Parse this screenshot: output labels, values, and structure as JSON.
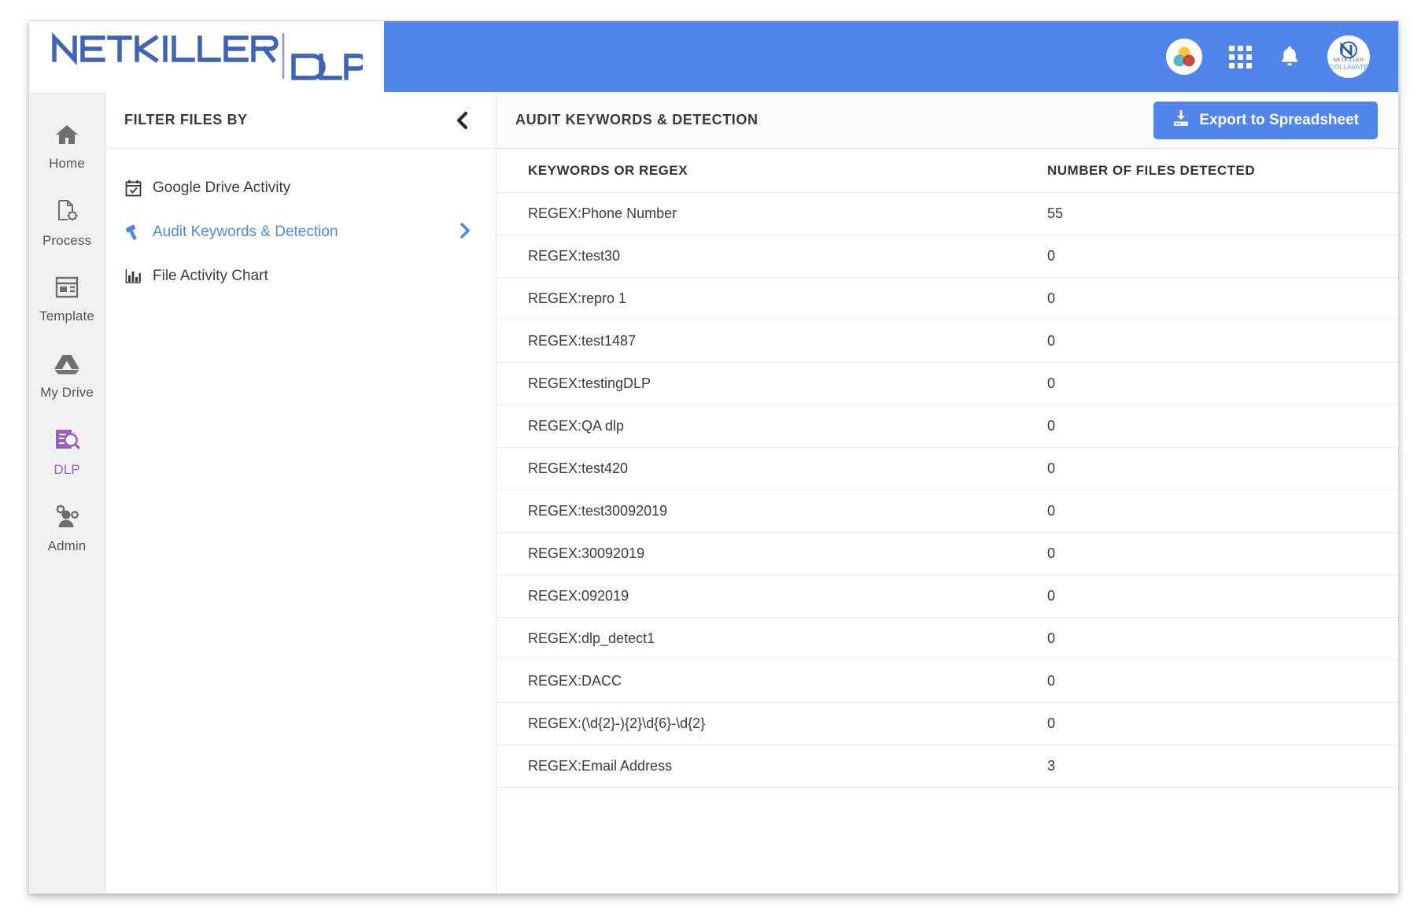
{
  "app": {
    "logo_primary": "NETKILLER",
    "logo_secondary": "DLP",
    "accent_blue": "#5185ec",
    "accent_purple": "#9b5fc0"
  },
  "topbar": {
    "icons": [
      {
        "name": "collavate-circles-icon",
        "label": "Collavate"
      },
      {
        "name": "apps-grid-icon",
        "label": "Apps"
      },
      {
        "name": "notifications-bell-icon",
        "label": "Notifications"
      },
      {
        "name": "account-avatar-icon",
        "label": "Netkiller Collavate"
      }
    ],
    "avatar_line1": "NETKILLER",
    "avatar_line2": "COLLAVATE"
  },
  "sidebar": {
    "items": [
      {
        "label": "Home",
        "icon": "home-icon",
        "active": false
      },
      {
        "label": "Process",
        "icon": "process-icon",
        "active": false
      },
      {
        "label": "Template",
        "icon": "template-icon",
        "active": false
      },
      {
        "label": "My Drive",
        "icon": "drive-icon",
        "active": false
      },
      {
        "label": "DLP",
        "icon": "dlp-icon",
        "active": true
      },
      {
        "label": "Admin",
        "icon": "admin-icon",
        "active": false
      }
    ]
  },
  "filter_panel": {
    "title": "FILTER FILES BY",
    "collapse_icon": "chevron-left-icon",
    "items": [
      {
        "label": "Google Drive Activity",
        "icon": "calendar-check-icon",
        "active": false,
        "chevron": false
      },
      {
        "label": "Audit Keywords & Detection",
        "icon": "gavel-icon",
        "active": true,
        "chevron": true
      },
      {
        "label": "File Activity Chart",
        "icon": "bar-chart-icon",
        "active": false,
        "chevron": false
      }
    ]
  },
  "main": {
    "title": "AUDIT KEYWORDS & DETECTION",
    "export_label": "Export to Spreadsheet",
    "export_icon": "download-export-icon",
    "table": {
      "columns": [
        "KEYWORDS OR REGEX",
        "NUMBER OF FILES DETECTED"
      ],
      "rows": [
        {
          "keyword": "REGEX:Phone Number",
          "count": "55"
        },
        {
          "keyword": "REGEX:test30",
          "count": "0"
        },
        {
          "keyword": "REGEX:repro 1",
          "count": "0"
        },
        {
          "keyword": "REGEX:test1487",
          "count": "0"
        },
        {
          "keyword": "REGEX:testingDLP",
          "count": "0"
        },
        {
          "keyword": "REGEX:QA dlp",
          "count": "0"
        },
        {
          "keyword": "REGEX:test420",
          "count": "0"
        },
        {
          "keyword": "REGEX:test30092019",
          "count": "0"
        },
        {
          "keyword": "REGEX:30092019",
          "count": "0"
        },
        {
          "keyword": "REGEX:092019",
          "count": "0"
        },
        {
          "keyword": "REGEX:dlp_detect1",
          "count": "0"
        },
        {
          "keyword": "REGEX:DACC",
          "count": "0"
        },
        {
          "keyword": "REGEX:(\\d{2}-){2}\\d{6}-\\d{2}",
          "count": "0"
        },
        {
          "keyword": "REGEX:Email Address",
          "count": "3"
        }
      ]
    }
  }
}
